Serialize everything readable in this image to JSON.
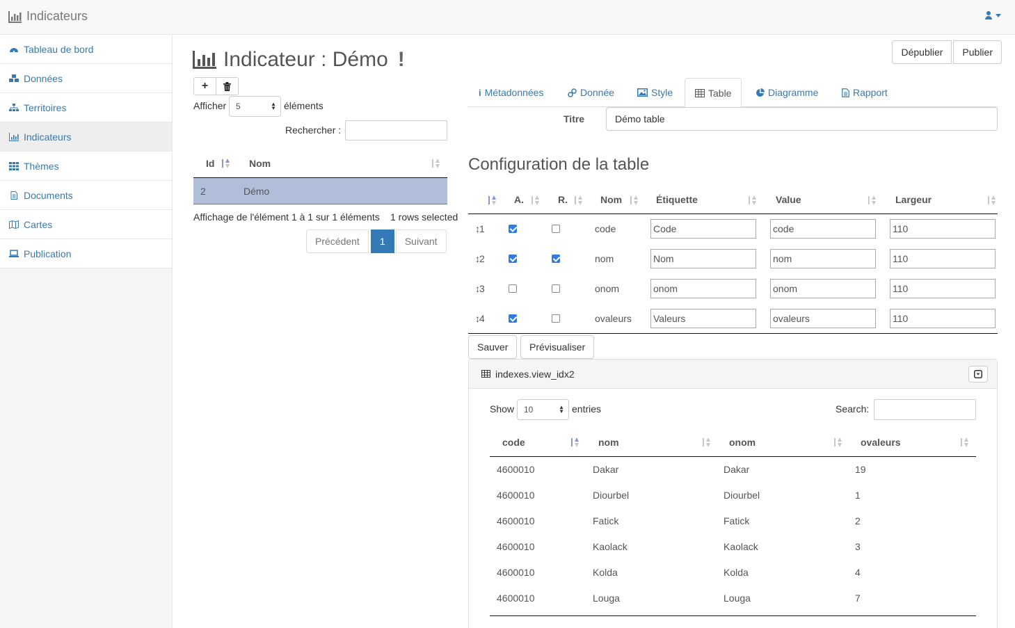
{
  "navbar": {
    "brand": "Indicateurs"
  },
  "sidebar": {
    "items": [
      {
        "label": "Tableau de bord",
        "icon": "dashboard-icon"
      },
      {
        "label": "Données",
        "icon": "cubes-icon"
      },
      {
        "label": "Territoires",
        "icon": "sitemap-icon"
      },
      {
        "label": "Indicateurs",
        "icon": "bar-chart-icon",
        "active": true
      },
      {
        "label": "Thèmes",
        "icon": "grid-icon"
      },
      {
        "label": "Documents",
        "icon": "file-icon"
      },
      {
        "label": "Cartes",
        "icon": "map-icon"
      },
      {
        "label": "Publication",
        "icon": "laptop-icon"
      }
    ]
  },
  "header": {
    "title": "Indicateur : Démo",
    "excl": "!",
    "unpublish_label": "Dépublier",
    "publish_label": "Publier"
  },
  "list": {
    "add_label": "+",
    "show_label": "Afficher",
    "show_value": "5",
    "elements_label": "éléments",
    "search_label": "Rechercher :",
    "columns": [
      "Id",
      "Nom"
    ],
    "rows": [
      {
        "id": "2",
        "nom": "Démo"
      }
    ],
    "info": "Affichage de l'élément 1 à 1 sur 1 éléments",
    "selected": "1 rows selected",
    "prev": "Précédent",
    "page": "1",
    "next": "Suivant"
  },
  "tabs": [
    {
      "label": "Métadonnées",
      "icon": "info-icon"
    },
    {
      "label": "Donnée",
      "icon": "link-icon"
    },
    {
      "label": "Style",
      "icon": "image-icon"
    },
    {
      "label": "Table",
      "icon": "table-icon",
      "active": true
    },
    {
      "label": "Diagramme",
      "icon": "pie-chart-icon"
    },
    {
      "label": "Rapport",
      "icon": "file-icon"
    }
  ],
  "form": {
    "titre_label": "Titre",
    "titre_value": "Démo table"
  },
  "config": {
    "title": "Configuration de la table",
    "columns": [
      "A.",
      "R.",
      "Nom",
      "Étiquette",
      "Value",
      "Largeur"
    ],
    "rows": [
      {
        "order": "1",
        "a": true,
        "r": false,
        "nom": "code",
        "etiquette": "Code",
        "value": "code",
        "largeur": "110"
      },
      {
        "order": "2",
        "a": true,
        "r": true,
        "nom": "nom",
        "etiquette": "Nom",
        "value": "nom",
        "largeur": "110"
      },
      {
        "order": "3",
        "a": false,
        "r": false,
        "nom": "onom",
        "etiquette": "onom",
        "value": "onom",
        "largeur": "110"
      },
      {
        "order": "4",
        "a": true,
        "r": false,
        "nom": "ovaleurs",
        "etiquette": "Valeurs",
        "value": "ovaleurs",
        "largeur": "110"
      }
    ],
    "save_label": "Sauver",
    "preview_label": "Prévisualiser"
  },
  "preview": {
    "title": "indexes.view_idx2",
    "show_label": "Show",
    "show_value": "10",
    "entries_label": "entries",
    "search_label": "Search:",
    "columns": [
      "code",
      "nom",
      "onom",
      "ovaleurs"
    ],
    "rows": [
      {
        "code": "4600010",
        "nom": "Dakar",
        "onom": "Dakar",
        "ovaleurs": "19"
      },
      {
        "code": "4600010",
        "nom": "Diourbel",
        "onom": "Diourbel",
        "ovaleurs": "1"
      },
      {
        "code": "4600010",
        "nom": "Fatick",
        "onom": "Fatick",
        "ovaleurs": "2"
      },
      {
        "code": "4600010",
        "nom": "Kaolack",
        "onom": "Kaolack",
        "ovaleurs": "3"
      },
      {
        "code": "4600010",
        "nom": "Kolda",
        "onom": "Kolda",
        "ovaleurs": "4"
      },
      {
        "code": "4600010",
        "nom": "Louga",
        "onom": "Louga",
        "ovaleurs": "7"
      }
    ]
  },
  "colors": {
    "link": "#337ab7",
    "selected_row": "#b0bed9",
    "checkbox": "#2f7bdf"
  }
}
